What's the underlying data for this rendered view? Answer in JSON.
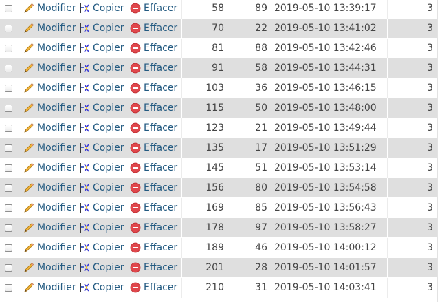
{
  "actions": {
    "edit_label": "Modifier",
    "copy_label": "Copier",
    "delete_label": "Effacer",
    "edit_icon": "pencil-icon",
    "copy_icon": "copy-insert-icon",
    "delete_icon": "delete-circle-icon"
  },
  "colors": {
    "link": "#235a81",
    "row_alt": "#dfdfdf",
    "delete_icon": "#e0474c"
  },
  "rows": [
    {
      "a": "58",
      "b": "89",
      "datetime": "2019-05-10 13:39:17",
      "n": "3"
    },
    {
      "a": "70",
      "b": "22",
      "datetime": "2019-05-10 13:41:02",
      "n": "3"
    },
    {
      "a": "81",
      "b": "88",
      "datetime": "2019-05-10 13:42:46",
      "n": "3"
    },
    {
      "a": "91",
      "b": "58",
      "datetime": "2019-05-10 13:44:31",
      "n": "3"
    },
    {
      "a": "103",
      "b": "36",
      "datetime": "2019-05-10 13:46:15",
      "n": "3"
    },
    {
      "a": "115",
      "b": "50",
      "datetime": "2019-05-10 13:48:00",
      "n": "3"
    },
    {
      "a": "123",
      "b": "21",
      "datetime": "2019-05-10 13:49:44",
      "n": "3"
    },
    {
      "a": "135",
      "b": "17",
      "datetime": "2019-05-10 13:51:29",
      "n": "3"
    },
    {
      "a": "145",
      "b": "51",
      "datetime": "2019-05-10 13:53:14",
      "n": "3"
    },
    {
      "a": "156",
      "b": "80",
      "datetime": "2019-05-10 13:54:58",
      "n": "3"
    },
    {
      "a": "169",
      "b": "85",
      "datetime": "2019-05-10 13:56:43",
      "n": "3"
    },
    {
      "a": "178",
      "b": "97",
      "datetime": "2019-05-10 13:58:27",
      "n": "3"
    },
    {
      "a": "189",
      "b": "46",
      "datetime": "2019-05-10 14:00:12",
      "n": "3"
    },
    {
      "a": "201",
      "b": "28",
      "datetime": "2019-05-10 14:01:57",
      "n": "3"
    },
    {
      "a": "210",
      "b": "31",
      "datetime": "2019-05-10 14:03:41",
      "n": "3"
    }
  ]
}
